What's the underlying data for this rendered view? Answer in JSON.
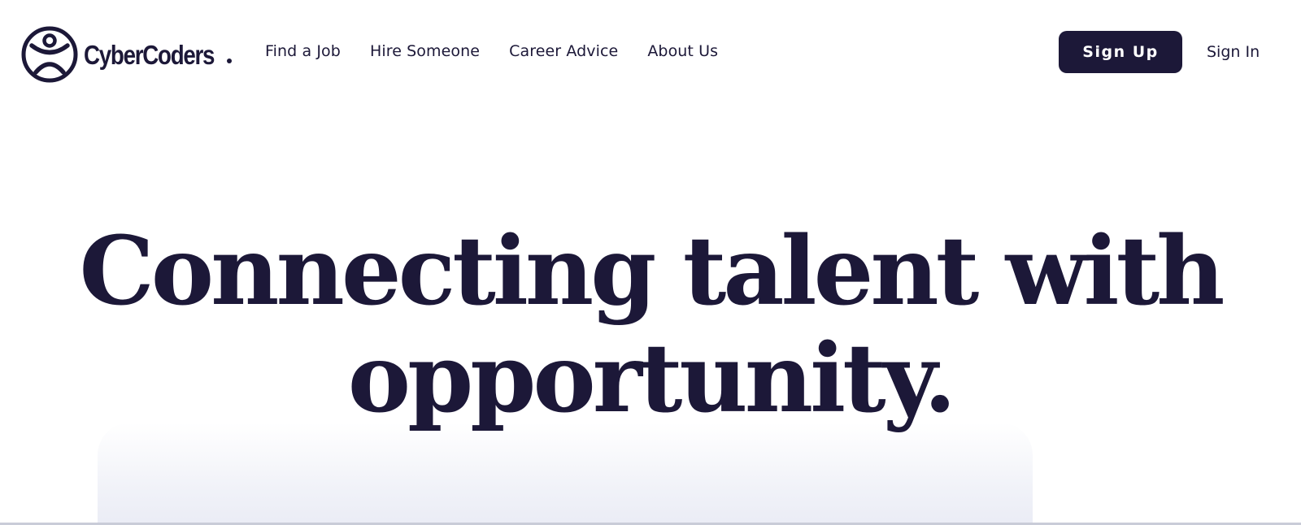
{
  "brand": {
    "name": "CyberCoders"
  },
  "nav": {
    "items": [
      {
        "label": "Find a Job"
      },
      {
        "label": "Hire Someone"
      },
      {
        "label": "Career Advice"
      },
      {
        "label": "About Us"
      }
    ]
  },
  "auth": {
    "signup_label": "Sign Up",
    "signin_label": "Sign In"
  },
  "hero": {
    "line1": "Connecting talent with",
    "line2": "opportunity."
  },
  "colors": {
    "brand_navy": "#1c1838",
    "background": "#ffffff"
  },
  "icons": {
    "logo": "cybercoders-logo-icon"
  }
}
